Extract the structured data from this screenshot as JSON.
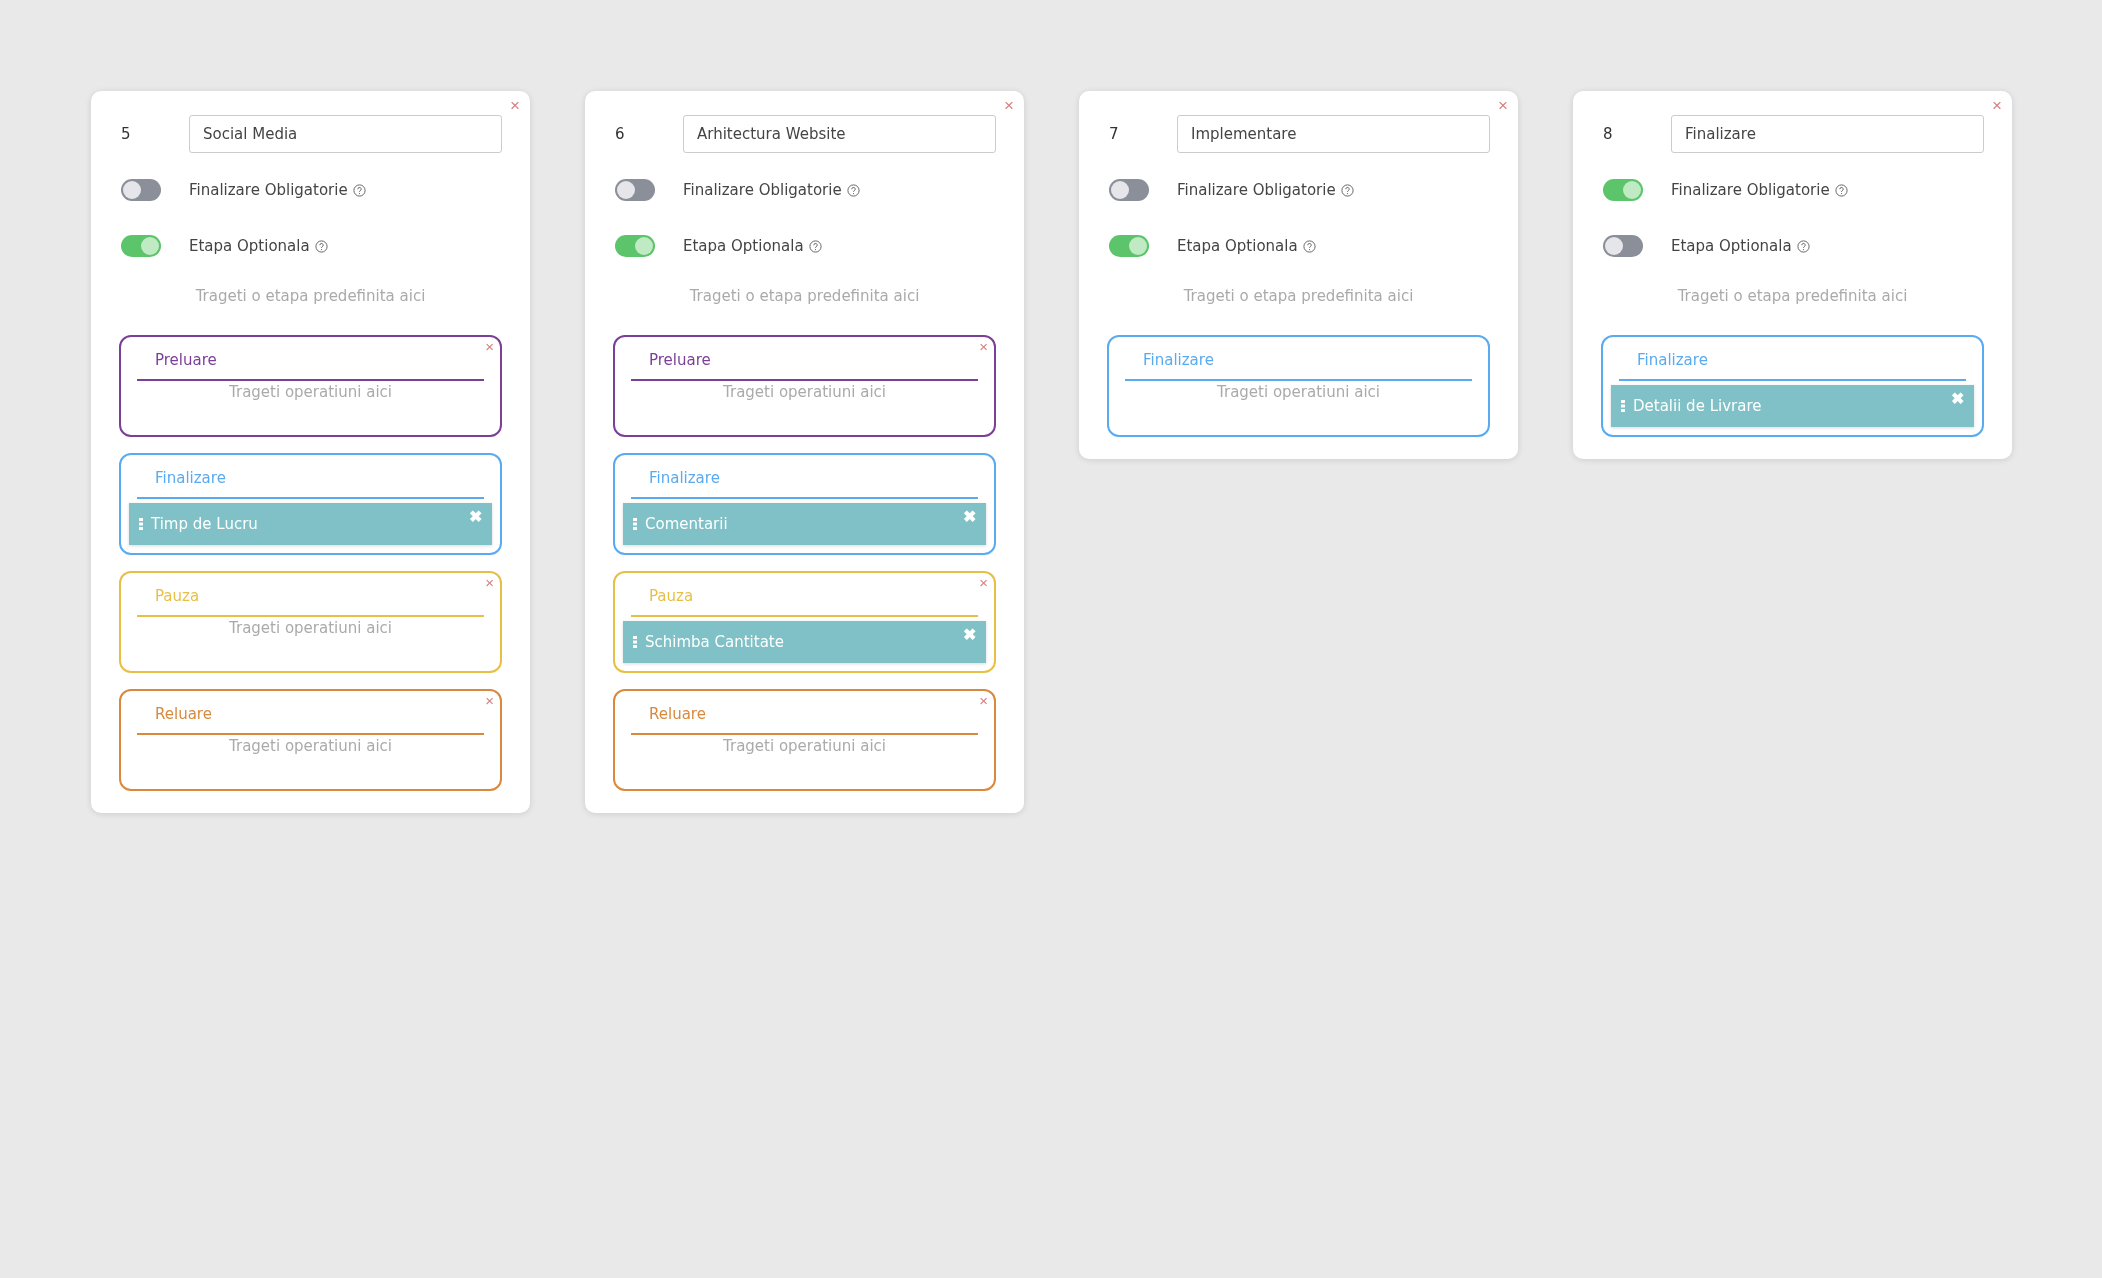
{
  "stages": [
    {
      "number": "5",
      "close": "×",
      "name": "Social Media",
      "mandatory_label": "Finalizare Obligatorie",
      "mandatory": false,
      "optional_label": "Etapa Optionala",
      "optional": true,
      "drop_hint": "Trageti o etapa predefinita aici",
      "groups": [
        {
          "title": "Preluare",
          "color": "#7b3f98",
          "close": "×",
          "hint": "Trageti operatiuni aici"
        },
        {
          "title": "Finalizare",
          "color": "#5aaaf0",
          "operations": [
            {
              "label": "Timp de Lucru",
              "remove": "✖"
            }
          ]
        },
        {
          "title": "Pauza",
          "color": "#e8bf45",
          "close": "×",
          "hint": "Trageti operatiuni aici"
        },
        {
          "title": "Reluare",
          "color": "#d8893d",
          "close": "×",
          "hint": "Trageti operatiuni aici"
        }
      ]
    },
    {
      "number": "6",
      "close": "×",
      "name": "Arhitectura Website",
      "mandatory_label": "Finalizare Obligatorie",
      "mandatory": false,
      "optional_label": "Etapa Optionala",
      "optional": true,
      "drop_hint": "Trageti o etapa predefinita aici",
      "groups": [
        {
          "title": "Preluare",
          "color": "#7b3f98",
          "close": "×",
          "hint": "Trageti operatiuni aici"
        },
        {
          "title": "Finalizare",
          "color": "#5aaaf0",
          "operations": [
            {
              "label": "Comentarii",
              "remove": "✖"
            }
          ]
        },
        {
          "title": "Pauza",
          "color": "#e8bf45",
          "close": "×",
          "operations": [
            {
              "label": "Schimba Cantitate",
              "remove": "✖"
            }
          ]
        },
        {
          "title": "Reluare",
          "color": "#d8893d",
          "close": "×",
          "hint": "Trageti operatiuni aici"
        }
      ]
    },
    {
      "number": "7",
      "close": "×",
      "name": "Implementare",
      "mandatory_label": "Finalizare Obligatorie",
      "mandatory": false,
      "optional_label": "Etapa Optionala",
      "optional": true,
      "drop_hint": "Trageti o etapa predefinita aici",
      "groups": [
        {
          "title": "Finalizare",
          "color": "#5aaaf0",
          "hint": "Trageti operatiuni aici"
        }
      ]
    },
    {
      "number": "8",
      "close": "×",
      "name": "Finalizare",
      "mandatory_label": "Finalizare Obligatorie",
      "mandatory": true,
      "optional_label": "Etapa Optionala",
      "optional": false,
      "drop_hint": "Trageti o etapa predefinita aici",
      "groups": [
        {
          "title": "Finalizare",
          "color": "#5aaaf0",
          "operations": [
            {
              "label": "Detalii de Livrare",
              "remove": "✖"
            }
          ]
        }
      ]
    }
  ]
}
